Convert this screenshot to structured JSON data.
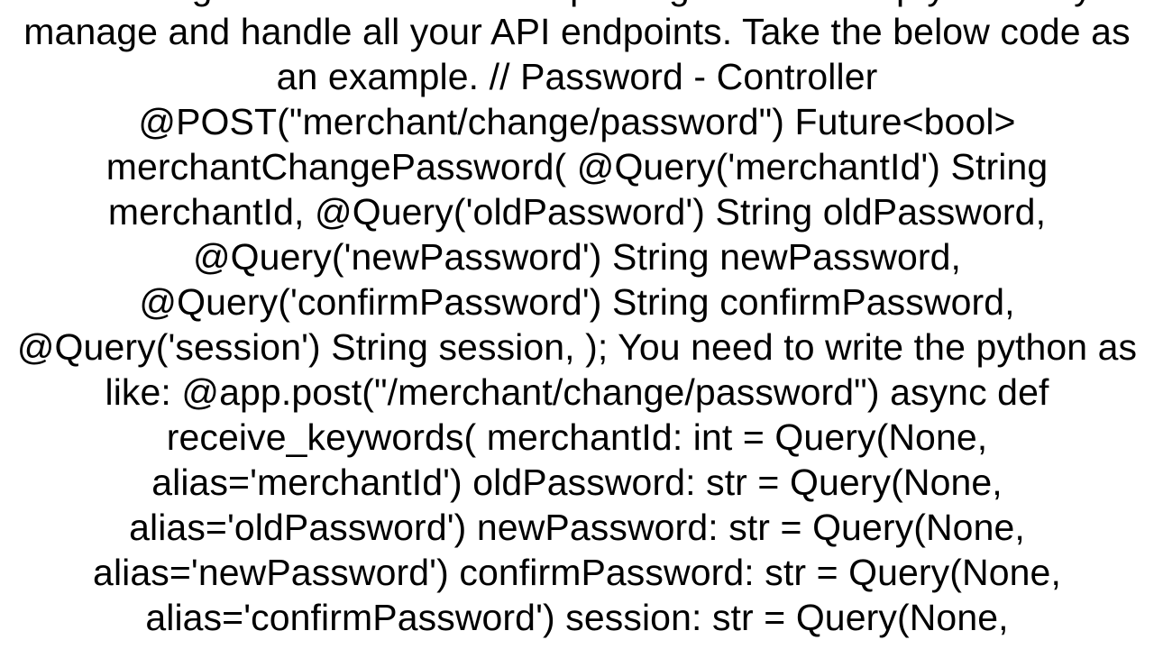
{
  "body": "API integration. And those two packages would help you easily manage and handle all your API endpoints. Take the below code as an example. // Password - Controller @POST(\"merchant/change/password\") Future<bool> merchantChangePassword(   @Query('merchantId') String merchantId,   @Query('oldPassword') String oldPassword,   @Query('newPassword') String newPassword,   @Query('confirmPassword') String confirmPassword,   @Query('session') String session, );  You need to write the python as like: @app.post(\"/merchant/change/password\") async def receive_keywords(     merchantId: int = Query(None, alias='merchantId')     oldPassword: str = Query(None, alias='oldPassword')     newPassword: str = Query(None, alias='newPassword')     confirmPassword: str = Query(None, alias='confirmPassword')     session: str = Query(None,"
}
